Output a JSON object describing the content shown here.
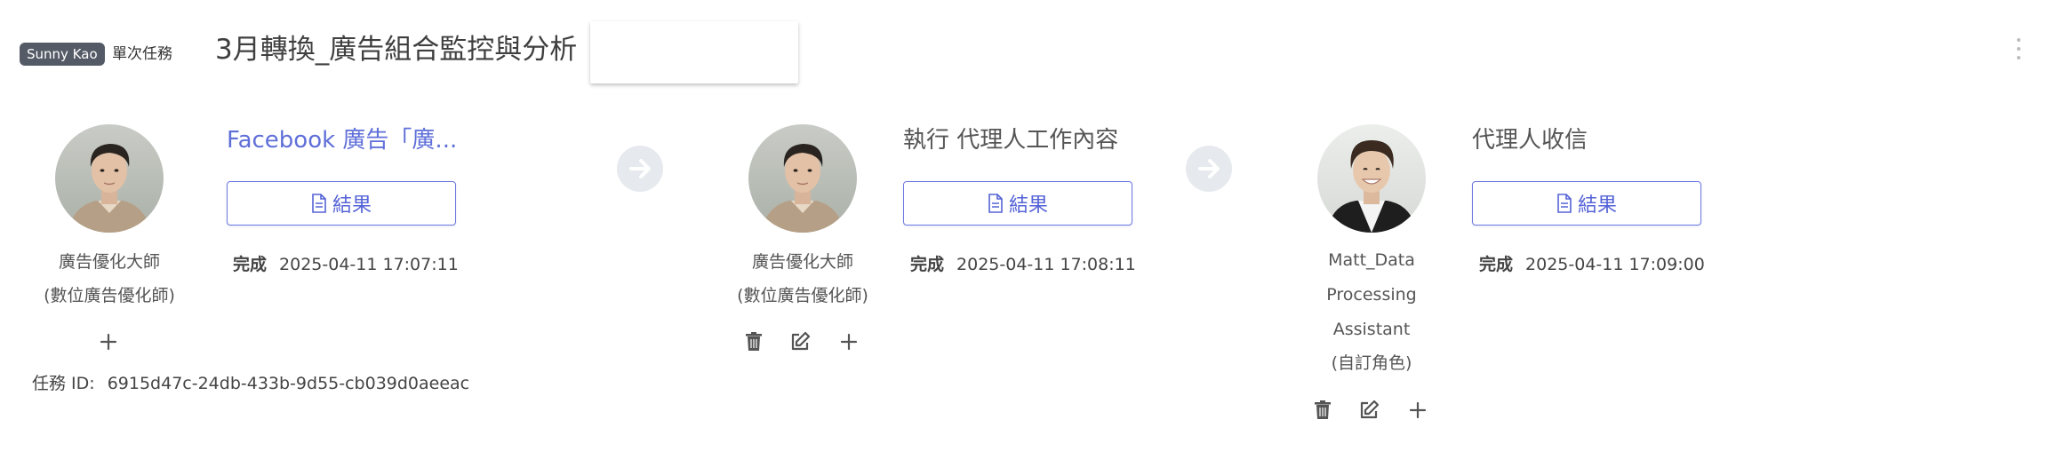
{
  "header": {
    "owner_badge": "Sunny Kao",
    "task_type": "單次任務",
    "title": "3月轉換_廣告組合監控與分析"
  },
  "steps": [
    {
      "agent_name": "廣告優化大師",
      "agent_role": "(數位廣告優化師)",
      "step_title": "Facebook 廣告「廣...",
      "result_label": "結果",
      "status": "完成",
      "timestamp": "2025-04-11 17:07:11"
    },
    {
      "agent_name": "廣告優化大師",
      "agent_role": "(數位廣告優化師)",
      "step_title": "執行 代理人工作內容",
      "result_label": "結果",
      "status": "完成",
      "timestamp": "2025-04-11 17:08:11"
    },
    {
      "agent_name_lines": [
        "Matt_Data",
        "Processing",
        "Assistant"
      ],
      "agent_role": "(自訂角色)",
      "step_title": "代理人收信",
      "result_label": "結果",
      "status": "完成",
      "timestamp": "2025-04-11 17:09:00"
    }
  ],
  "task_id": {
    "label": "任務 ID:",
    "value": "6915d47c-24db-433b-9d55-cb039d0aeeac"
  },
  "icons": {
    "kebab": "more-vertical-icon",
    "arrow": "arrow-right-circle-icon",
    "delete": "trash-icon",
    "edit": "edit-icon",
    "add": "plus-icon",
    "result": "document-icon"
  },
  "colors": {
    "accent": "#5f6fd8",
    "badge_bg": "#555b66",
    "arrow_bg": "#e6e9ed"
  }
}
